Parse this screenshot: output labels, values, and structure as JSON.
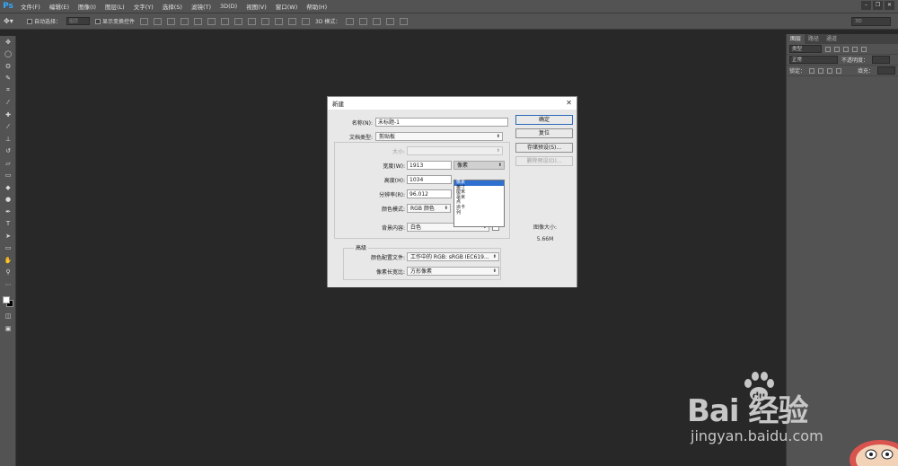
{
  "app": {
    "logo": "Ps"
  },
  "menu": [
    "文件(F)",
    "编辑(E)",
    "图像(I)",
    "图层(L)",
    "文字(Y)",
    "选择(S)",
    "滤镜(T)",
    "3D(D)",
    "视图(V)",
    "窗口(W)",
    "帮助(H)"
  ],
  "options": {
    "auto_select_label": "自动选择：",
    "auto_select_value": "图层",
    "show_transform_label": "显示变换控件",
    "mode_3d_label": "3D 模式：",
    "workspace_value": "3D"
  },
  "right_panel": {
    "tabs": [
      "图层",
      "路径",
      "通道"
    ],
    "filter_kind": "类型",
    "blend_mode": "正常",
    "opacity_label": "不透明度：",
    "lock_label": "锁定：",
    "fill_label": "填充："
  },
  "dialog": {
    "title": "新建",
    "close": "✕",
    "name_label": "名称(N):",
    "name_value": "未标题-1",
    "preset_label": "文档类型:",
    "preset_value": "剪贴板",
    "size_label": "大小:",
    "width_label": "宽度(W):",
    "width_value": "1913",
    "height_label": "高度(H):",
    "height_value": "1034",
    "resolution_label": "分辨率(R):",
    "resolution_value": "96.012",
    "color_mode_label": "颜色模式:",
    "color_mode_value": "RGB 颜色",
    "bg_label": "背景内容:",
    "bg_value": "白色",
    "advanced_label": "高级",
    "profile_label": "颜色配置文件:",
    "profile_value": "工作中的 RGB: sRGB IEC619...",
    "aspect_label": "像素长宽比:",
    "aspect_value": "方形像素",
    "unit_value": "像素",
    "unit_options": [
      "像素",
      "英寸",
      "厘米",
      "毫米",
      "点",
      "派卡",
      "列"
    ],
    "buttons": {
      "ok": "确定",
      "reset": "复位",
      "save_preset": "存储预设(S)...",
      "delete_preset": "删除预设(D)..."
    },
    "image_size_label": "图像大小:",
    "image_size_value": "5.66M"
  },
  "watermark": {
    "brand": "Bai  经验",
    "url": "jingyan.baidu.com"
  }
}
